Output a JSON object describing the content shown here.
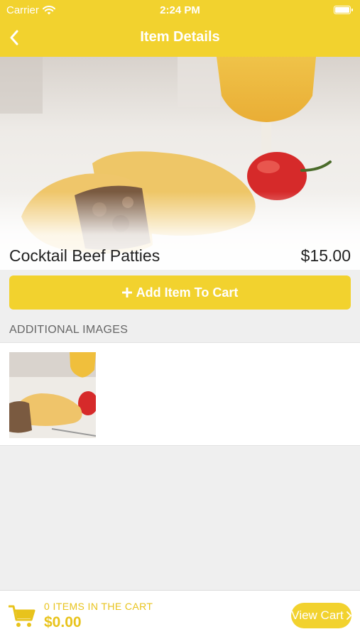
{
  "status_bar": {
    "carrier": "Carrier",
    "time": "2:24 PM"
  },
  "nav": {
    "title": "Item Details",
    "back_icon": "chevron-left-icon"
  },
  "product": {
    "name": "Cocktail Beef Patties",
    "price": "$15.00"
  },
  "add_to_cart": {
    "label": "Add Item To Cart",
    "icon": "plus-icon"
  },
  "additional_images": {
    "header": "ADDITIONAL IMAGES"
  },
  "cart_bar": {
    "count_text": "0 ITEMS IN THE CART",
    "total": "$0.00",
    "view_cart_label": "View Cart",
    "cart_icon": "shopping-cart-icon"
  },
  "colors": {
    "accent": "#f2d22e",
    "accent_text": "#e8c31c",
    "background": "#efefef"
  }
}
